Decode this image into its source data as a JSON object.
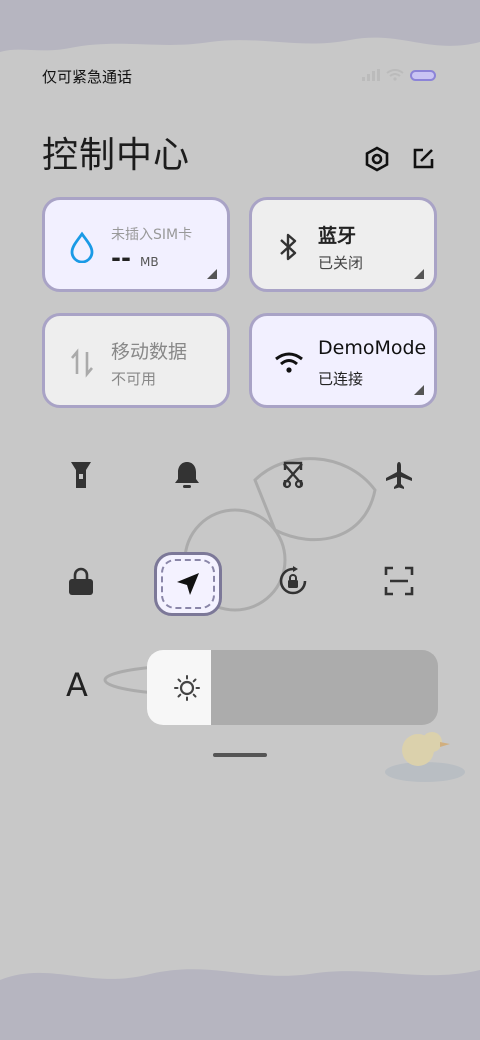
{
  "status_bar": {
    "carrier_text": "仅可紧急通话",
    "signal_icon": "signal-icon",
    "wifi_icon": "wifi-icon",
    "battery_icon": "battery-icon",
    "battery_color": "#8c84d8"
  },
  "header": {
    "title": "控制中心",
    "settings_icon": "hexagon-settings-icon",
    "edit_icon": "edit-icon"
  },
  "tiles": {
    "data_usage": {
      "title": "未插入SIM卡",
      "value": "--",
      "unit": "MB",
      "icon": "water-drop-icon",
      "accent": "#1a9ae6"
    },
    "bluetooth": {
      "title": "蓝牙",
      "status": "已关闭",
      "icon": "bluetooth-icon"
    },
    "mobile_data": {
      "title": "移动数据",
      "status": "不可用",
      "icon": "mobile-data-arrows-icon"
    },
    "wifi": {
      "title": "DemoMode",
      "status": "已连接",
      "icon": "wifi-icon"
    }
  },
  "quick_toggles": [
    {
      "name": "flashlight",
      "icon": "flashlight-icon"
    },
    {
      "name": "ring",
      "icon": "bell-icon"
    },
    {
      "name": "screenshot",
      "icon": "screenshot-scissors-icon"
    },
    {
      "name": "airplane",
      "icon": "airplane-icon"
    },
    {
      "name": "lock-screen",
      "icon": "lock-icon"
    },
    {
      "name": "location",
      "icon": "location-arrow-icon",
      "active": true
    },
    {
      "name": "rotation-lock",
      "icon": "rotation-lock-icon"
    },
    {
      "name": "scanner",
      "icon": "scan-frame-icon"
    }
  ],
  "font_button": {
    "label": "A"
  },
  "brightness": {
    "level": 0.22,
    "icon": "sun-icon"
  },
  "colors": {
    "background": "#c8c8c8",
    "tile_active": "#f2f0ff",
    "tile_border": "#a9a3c6"
  }
}
